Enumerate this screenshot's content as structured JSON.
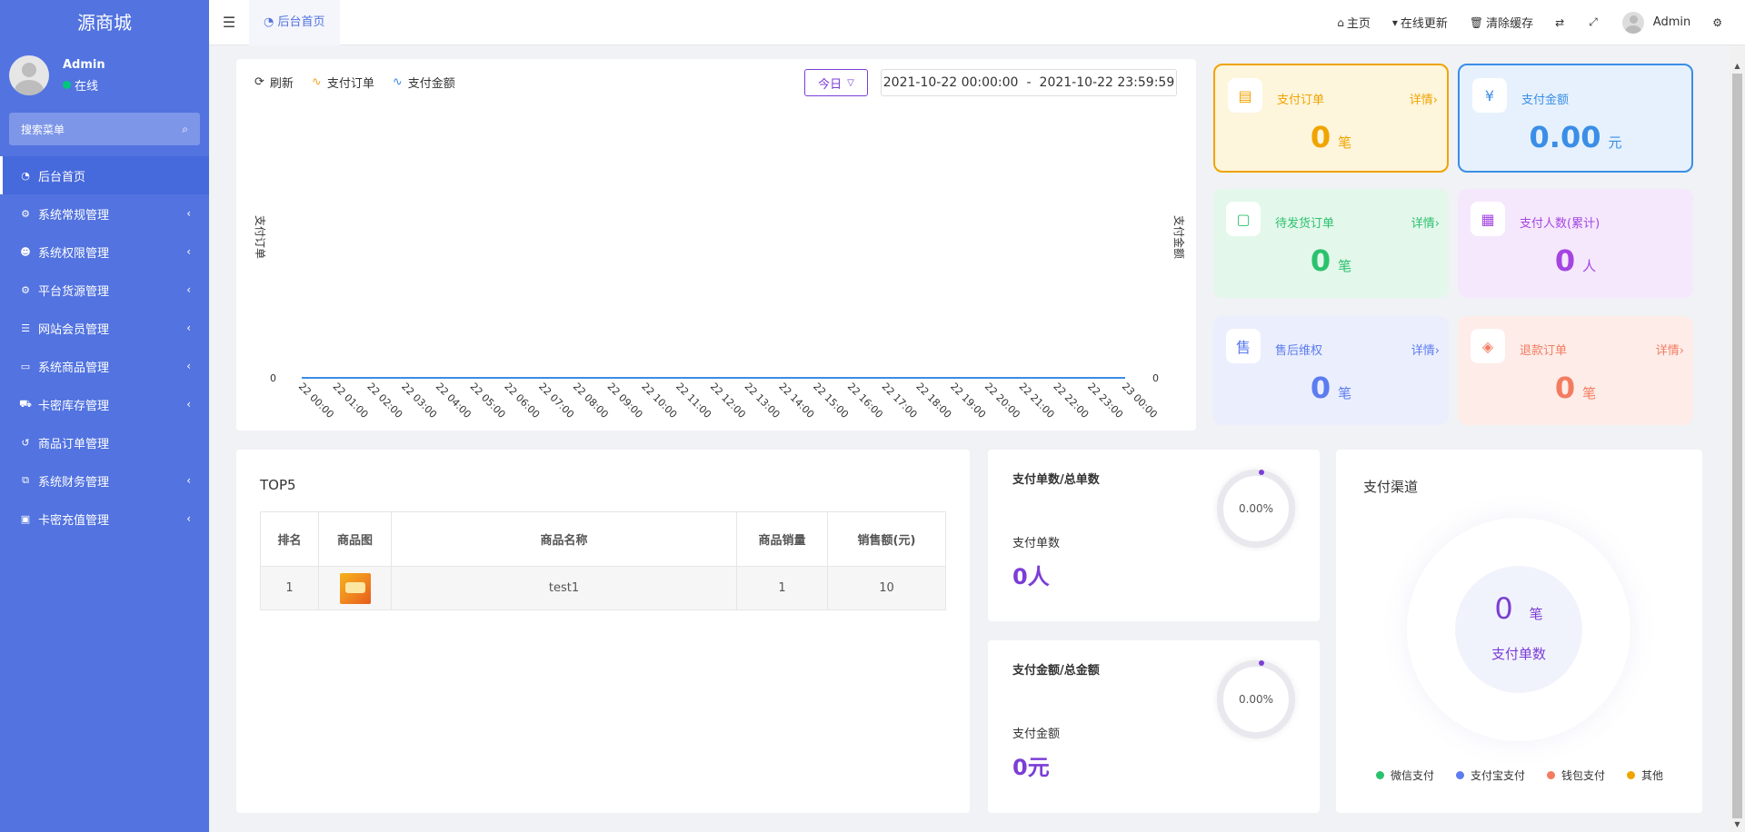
{
  "sidebar": {
    "brand": "源商城",
    "user_name": "Admin",
    "user_status": "在线",
    "search_placeholder": "搜索菜单",
    "items": [
      {
        "label": "后台首页",
        "icon": "dashboard-icon",
        "glyph": "◔",
        "active": true,
        "has_children": false
      },
      {
        "label": "系统常规管理",
        "icon": "cogs-icon",
        "glyph": "⚙",
        "active": false,
        "has_children": true
      },
      {
        "label": "系统权限管理",
        "icon": "users-icon",
        "glyph": "☻",
        "active": false,
        "has_children": true
      },
      {
        "label": "平台货源管理",
        "icon": "cogs-icon",
        "glyph": "⚙",
        "active": false,
        "has_children": true
      },
      {
        "label": "网站会员管理",
        "icon": "list-icon",
        "glyph": "☰",
        "active": false,
        "has_children": true
      },
      {
        "label": "系统商品管理",
        "icon": "card-icon",
        "glyph": "▭",
        "active": false,
        "has_children": true
      },
      {
        "label": "卡密库存管理",
        "icon": "cart-icon",
        "glyph": "⛟",
        "active": false,
        "has_children": true
      },
      {
        "label": "商品订单管理",
        "icon": "history-icon",
        "glyph": "↺",
        "active": false,
        "has_children": false
      },
      {
        "label": "系统财务管理",
        "icon": "binoculars-icon",
        "glyph": "⧉",
        "active": false,
        "has_children": true
      },
      {
        "label": "卡密充值管理",
        "icon": "money-icon",
        "glyph": "▣",
        "active": false,
        "has_children": true
      }
    ]
  },
  "topbar": {
    "tab_label": "后台首页",
    "home": "主页",
    "update": "在线更新",
    "clear_cache": "清除缓存",
    "user": "Admin"
  },
  "chart_toolbar": {
    "refresh": "刷新",
    "legend_orders": "支付订单",
    "legend_amount": "支付金额",
    "today": "今日",
    "date_start": "2021-10-22 00:00:00",
    "date_sep": "-",
    "date_end": "2021-10-22 23:59:59"
  },
  "chart_data": {
    "type": "line",
    "title": "",
    "ylabel_left": "支付订单",
    "ylabel_right": "支付金额",
    "x": [
      "22 00:00",
      "22 01:00",
      "22 02:00",
      "22 03:00",
      "22 04:00",
      "22 05:00",
      "22 06:00",
      "22 07:00",
      "22 08:00",
      "22 09:00",
      "22 10:00",
      "22 11:00",
      "22 12:00",
      "22 13:00",
      "22 14:00",
      "22 15:00",
      "22 16:00",
      "22 17:00",
      "22 18:00",
      "22 19:00",
      "22 20:00",
      "22 21:00",
      "22 22:00",
      "22 23:00",
      "23 00:00"
    ],
    "series": [
      {
        "name": "支付订单",
        "color": "#f5a623",
        "values": [
          0,
          0,
          0,
          0,
          0,
          0,
          0,
          0,
          0,
          0,
          0,
          0,
          0,
          0,
          0,
          0,
          0,
          0,
          0,
          0,
          0,
          0,
          0,
          0,
          0
        ]
      },
      {
        "name": "支付金额",
        "color": "#3a8ee6",
        "values": [
          0,
          0,
          0,
          0,
          0,
          0,
          0,
          0,
          0,
          0,
          0,
          0,
          0,
          0,
          0,
          0,
          0,
          0,
          0,
          0,
          0,
          0,
          0,
          0,
          0
        ]
      }
    ],
    "y_left_ticks": [
      "0"
    ],
    "y_right_ticks": [
      "0"
    ],
    "grid": false,
    "legend": "top-left"
  },
  "stats": {
    "paid_orders": {
      "title": "支付订单",
      "detail": "详情",
      "value": "0",
      "unit": "笔",
      "color": "#f0a400",
      "bg": "#fdf5dc"
    },
    "paid_amount": {
      "title": "支付金额",
      "value": "0.00",
      "unit": "元",
      "color": "#3a8ee6",
      "bg": "#e6f1fd"
    },
    "pending_ship": {
      "title": "待发货订单",
      "detail": "详情",
      "value": "0",
      "unit": "笔",
      "color": "#2cc26d",
      "bg": "#e3f7eb"
    },
    "paid_users": {
      "title": "支付人数(累计)",
      "value": "0",
      "unit": "人",
      "color": "#a445e2",
      "bg": "#f5e8fc"
    },
    "after_sales": {
      "title": "售后维权",
      "detail": "详情",
      "value": "0",
      "unit": "笔",
      "color": "#5c7cf0",
      "bg": "#ebeefd"
    },
    "refund_orders": {
      "title": "退款订单",
      "detail": "详情",
      "value": "0",
      "unit": "笔",
      "color": "#f37c60",
      "bg": "#fdece8"
    }
  },
  "top5": {
    "title": "TOP5",
    "headers": [
      "排名",
      "商品图",
      "商品名称",
      "商品销量",
      "销售额(元)"
    ],
    "rows": [
      {
        "rank": "1",
        "name": "test1",
        "sales": "1",
        "amount": "10"
      }
    ]
  },
  "ratios": {
    "orders": {
      "title": "支付单数/总单数",
      "percent": "0.00%",
      "label": "支付单数",
      "value": "0人"
    },
    "amount": {
      "title": "支付金额/总金额",
      "percent": "0.00%",
      "label": "支付金额",
      "value": "0元"
    }
  },
  "channel": {
    "title": "支付渠道",
    "value": "0",
    "unit": "笔",
    "label": "支付单数",
    "legend": [
      {
        "name": "微信支付",
        "color": "#2cc26d"
      },
      {
        "name": "支付宝支付",
        "color": "#5c7cf0"
      },
      {
        "name": "钱包支付",
        "color": "#f37c60"
      },
      {
        "name": "其他",
        "color": "#f0a400"
      }
    ]
  }
}
